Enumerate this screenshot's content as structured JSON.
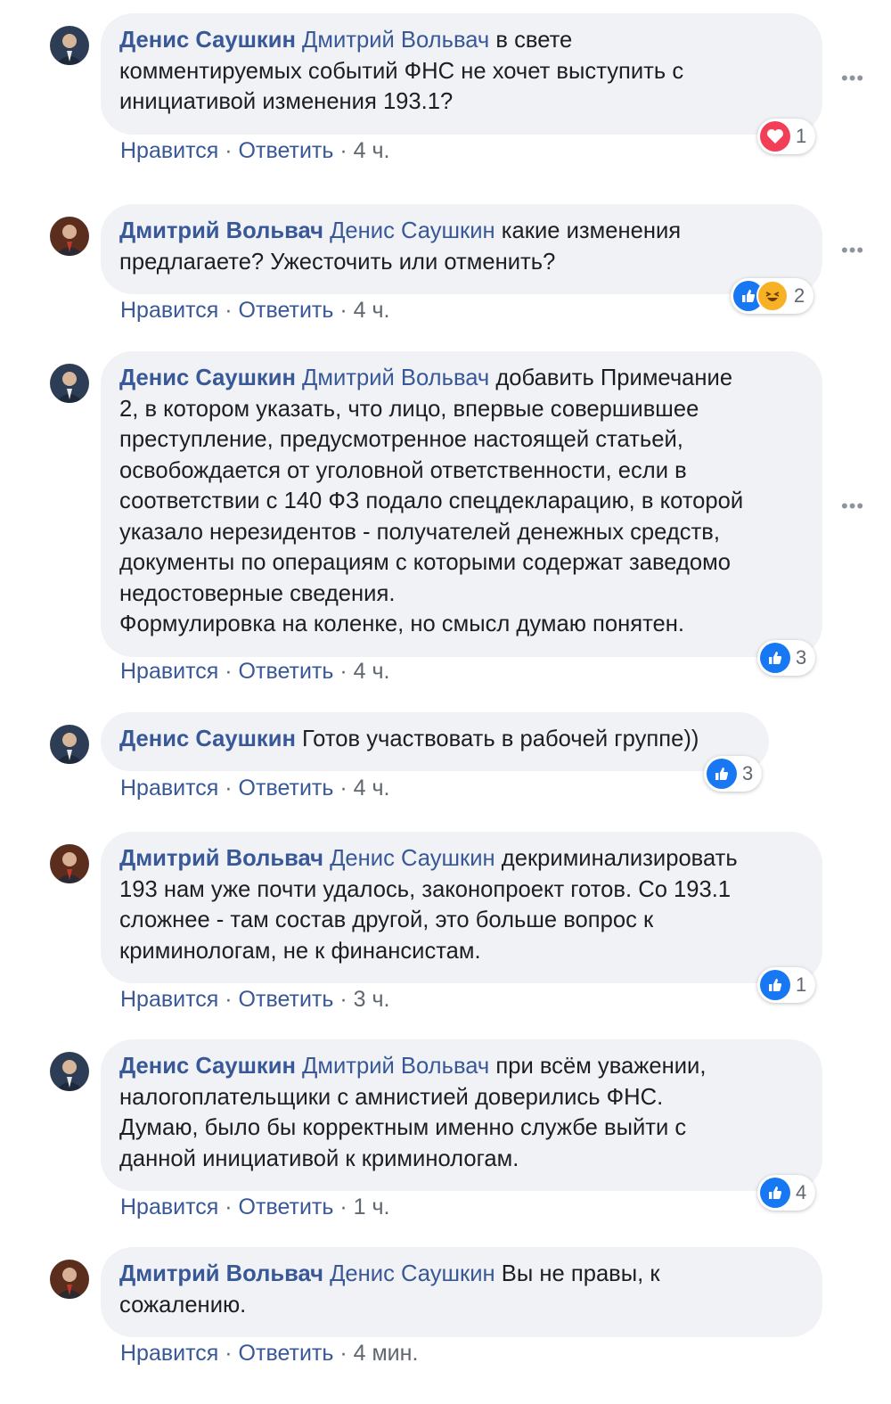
{
  "comments": [
    {
      "author": "Денис Саушкин",
      "mention": "Дмитрий Вольвач",
      "text": " в свете\nкомментируемых событий ФНС не хочет выступить с\nинициативой изменения 193.1?",
      "like_label": "Нравится",
      "reply_label": "Ответить",
      "time": "4 ч.",
      "reactions": [
        "love-icon"
      ],
      "reaction_count": "1"
    },
    {
      "author": "Дмитрий Вольвач",
      "mention": "Денис Саушкин",
      "text": " какие изменения\nпредлагаете? Ужесточить или отменить?",
      "like_label": "Нравится",
      "reply_label": "Ответить",
      "time": "4 ч.",
      "reactions": [
        "like-icon",
        "haha-icon"
      ],
      "reaction_count": "2"
    },
    {
      "author": "Денис Саушкин",
      "mention": "Дмитрий Вольвач",
      "text": " добавить Примечание\n2, в котором указать, что лицо, впервые совершившее\nпреступление, предусмотренное настоящей статьей,\nосвобождается от уголовной ответственности, если в\nсоответствии с 140 ФЗ подало спецдекларацию, в которой\nуказало нерезидентов - получателей денежных средств,\nдокументы по операциям с которыми содержат заведомо\nнедостоверные сведения.\nФормулировка на коленке, но смысл думаю понятен.",
      "like_label": "Нравится",
      "reply_label": "Ответить",
      "time": "4 ч.",
      "reactions": [
        "like-icon"
      ],
      "reaction_count": "3"
    },
    {
      "author": "Денис Саушкин",
      "mention": "",
      "text": " Готов участвовать в рабочей группе))",
      "like_label": "Нравится",
      "reply_label": "Ответить",
      "time": "4 ч.",
      "reactions": [
        "like-icon"
      ],
      "reaction_count": "3"
    },
    {
      "author": "Дмитрий Вольвач",
      "mention": "Денис Саушкин",
      "text": " декриминализировать\n193 нам уже почти удалось, законопроект готов. Со 193.1\nсложнее - там состав другой, это больше вопрос к\nкриминологам, не к финансистам.",
      "like_label": "Нравится",
      "reply_label": "Ответить",
      "time": "3 ч.",
      "reactions": [
        "like-icon"
      ],
      "reaction_count": "1"
    },
    {
      "author": "Денис Саушкин",
      "mention": "Дмитрий Вольвач",
      "text": " при всём уважении,\nналогоплательщики с амнистией доверились ФНС.\nДумаю, было бы корректным именно службе выйти с\nданной инициативой к криминологам.",
      "like_label": "Нравится",
      "reply_label": "Ответить",
      "time": "1 ч.",
      "reactions": [
        "like-icon"
      ],
      "reaction_count": "4"
    },
    {
      "author": "Дмитрий Вольвач",
      "mention": "Денис Саушкин",
      "text": " Вы не правы, к\nсожалению.",
      "like_label": "Нравится",
      "reply_label": "Ответить",
      "time": "4 мин.",
      "reactions": [],
      "reaction_count": ""
    }
  ],
  "separator": " · ",
  "more_icon": "more-options-icon",
  "colors": {
    "link": "#385898",
    "bubble": "#f0f2f5",
    "meta": "#606770",
    "like": "#1877f2",
    "love": "#f33e58"
  }
}
